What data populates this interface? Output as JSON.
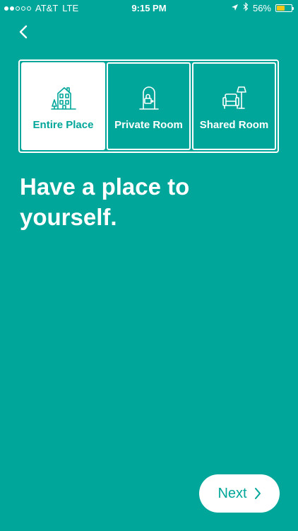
{
  "status_bar": {
    "carrier": "AT&T",
    "network": "LTE",
    "time": "9:15 PM",
    "battery_percent": "56%",
    "battery_level": 0.56,
    "signal_bars_filled": 2,
    "signal_bars_total": 5,
    "battery_color": "#F5C518"
  },
  "navigation": {
    "back_icon": "chevron-left-icon"
  },
  "room_types": {
    "selected_index": 0,
    "options": [
      {
        "label": "Entire Place",
        "icon": "house-icon"
      },
      {
        "label": "Private Room",
        "icon": "door-lock-icon"
      },
      {
        "label": "Shared Room",
        "icon": "armchair-lamp-icon"
      }
    ]
  },
  "headline": "Have a place to yourself.",
  "next_button": {
    "label": "Next",
    "icon": "chevron-right-icon"
  },
  "colors": {
    "background": "#00A699",
    "foreground": "#FFFFFF"
  }
}
